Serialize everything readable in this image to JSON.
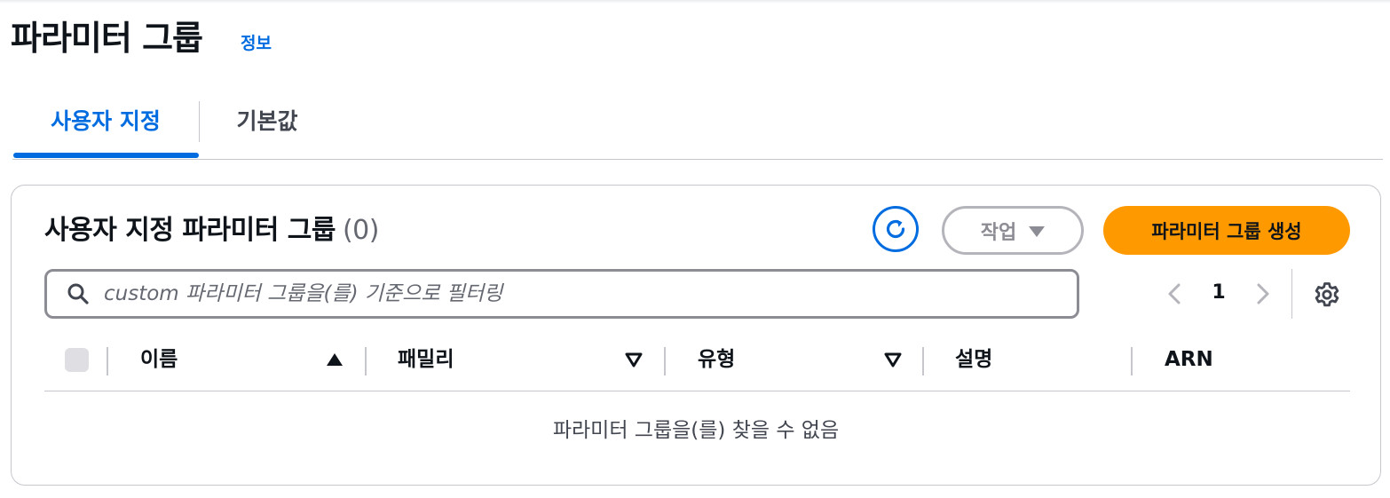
{
  "page": {
    "title": "파라미터 그룹",
    "info_link": "정보"
  },
  "tabs": [
    {
      "label": "사용자 지정",
      "selected": true
    },
    {
      "label": "기본값",
      "selected": false
    }
  ],
  "panel": {
    "title": "사용자 지정 파라미터 그룹",
    "count": "(0)",
    "refresh_icon": "refresh-icon",
    "actions_label": "작업",
    "create_label": "파라미터 그룹 생성",
    "search_placeholder": "custom 파라미터 그룹을(를) 기준으로 필터링",
    "search_value": "",
    "pagination": {
      "current_page": "1",
      "prev_icon": "chevron-left-icon",
      "next_icon": "chevron-right-icon",
      "settings_icon": "gear-icon"
    },
    "table": {
      "columns": [
        {
          "label": "이름",
          "sort": "ascending"
        },
        {
          "label": "패밀리",
          "sort": "sortable"
        },
        {
          "label": "유형",
          "sort": "sortable"
        },
        {
          "label": "설명",
          "sort": "none"
        },
        {
          "label": "ARN",
          "sort": "none"
        }
      ],
      "rows": [],
      "empty_message": "파라미터 그룹을(를) 찾을 수 없음"
    }
  },
  "colors": {
    "accent": "#006ce0",
    "primary_button": "#ff9900",
    "border": "#c6c6cd",
    "disabled": "#8c8c94"
  }
}
